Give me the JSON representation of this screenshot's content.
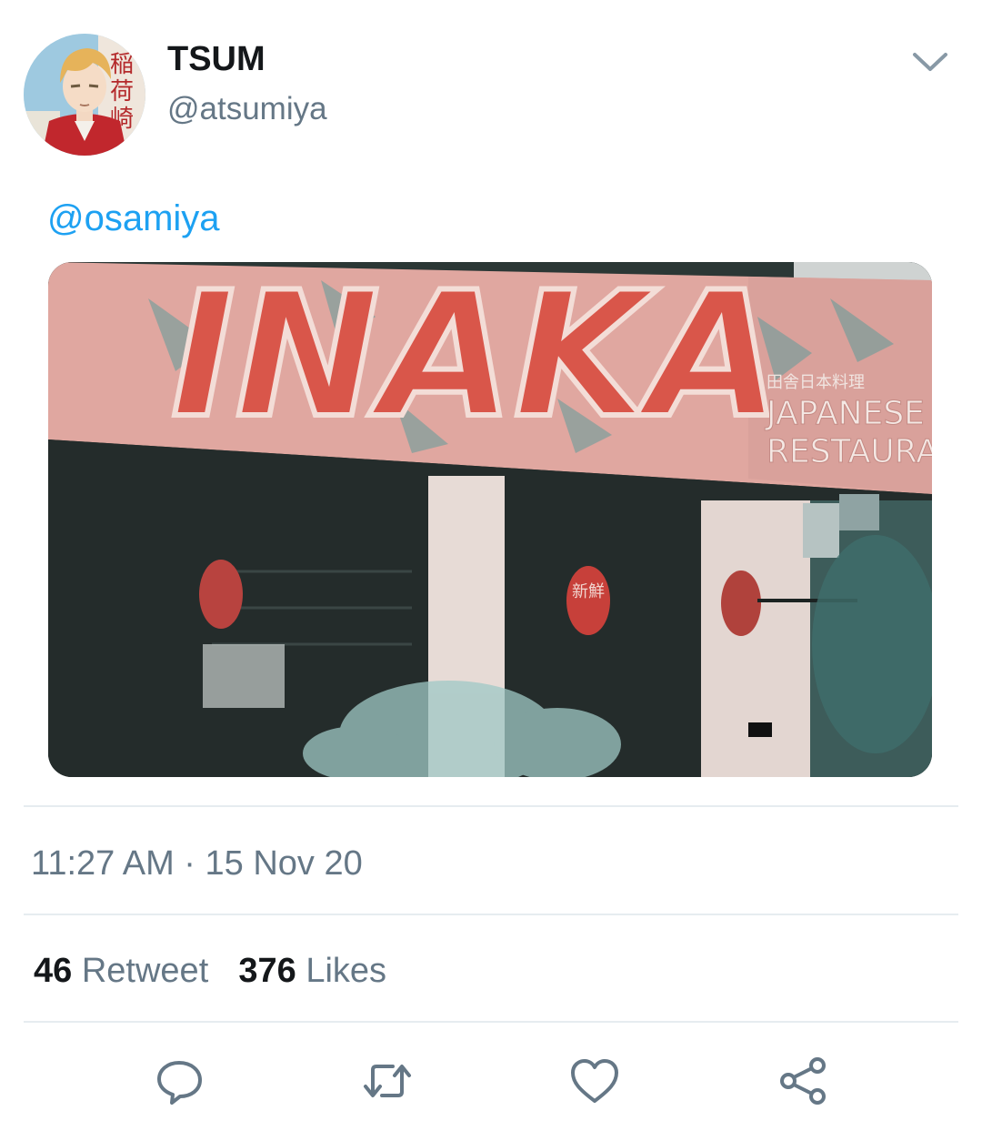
{
  "tweet": {
    "author": {
      "display_name": "TSUM",
      "handle": "@atsumiya",
      "avatar_icon": "avatar-icon"
    },
    "text": "@osamiya",
    "media": {
      "sign_text": "INAKA",
      "sign_sub_kanji": "田舎日本料理",
      "sign_sub_line1": "JAPANESE",
      "sign_sub_line2": "RESTAURANT",
      "lantern_text": "新鮮"
    },
    "timestamp": "11:27 AM · 15 Nov 20",
    "stats": {
      "retweets_count": "46",
      "retweets_label": "Retweet",
      "likes_count": "376",
      "likes_label": "Likes"
    },
    "actions": [
      "reply-icon",
      "retweet-icon",
      "like-icon",
      "share-icon"
    ]
  },
  "colors": {
    "link": "#1da1f2",
    "secondary": "#657786",
    "divider": "#e6ecf0"
  }
}
